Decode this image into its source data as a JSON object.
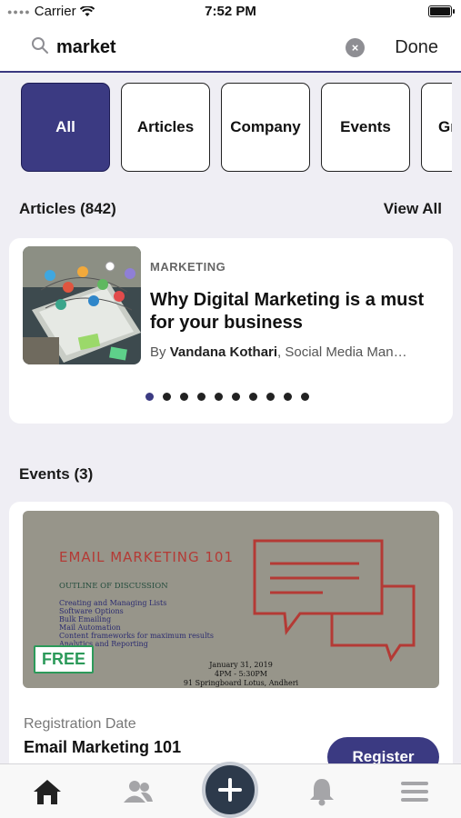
{
  "status_bar": {
    "carrier": "Carrier",
    "time": "7:52 PM"
  },
  "search": {
    "query": "market",
    "done_label": "Done",
    "clear_icon": "×"
  },
  "filters": [
    {
      "label": "All",
      "active": true
    },
    {
      "label": "Articles",
      "active": false
    },
    {
      "label": "Company",
      "active": false
    },
    {
      "label": "Events",
      "active": false
    },
    {
      "label": "Gr",
      "active": false
    }
  ],
  "articles_section": {
    "title": "Articles (842)",
    "view_all": "View All"
  },
  "article": {
    "tag": "MARKETING",
    "title": "Why Digital Marketing is a must for your business",
    "by_prefix": "By ",
    "author": "Vandana Kothari",
    "author_role": ", Social Media Man…",
    "pager_count": 10,
    "pager_active": 0
  },
  "events_section": {
    "title": "Events (3)"
  },
  "event": {
    "image_title": "EMAIL MARKETING 101",
    "image_outline": "OUTLINE OF DISCUSSION",
    "image_list": [
      "Creating and Managing Lists",
      "Software Options",
      "Bulk Emailing",
      "Mail Automation",
      "Content frameworks for maximum results",
      "Analytics and Reporting"
    ],
    "image_date": [
      "January 31, 2019",
      "4PM - 5:30PM",
      "91 Springboard Lotus, Andheri"
    ],
    "badge": "FREE",
    "registration_label": "Registration Date",
    "name": "Email Marketing 101",
    "register_label": "Register"
  },
  "colors": {
    "accent": "#3b3a82",
    "free": "#2c9a5a",
    "event_red": "#b43a35"
  },
  "tab_bar": [
    "home-icon",
    "people-icon",
    "add-icon",
    "bell-icon",
    "menu-icon"
  ]
}
